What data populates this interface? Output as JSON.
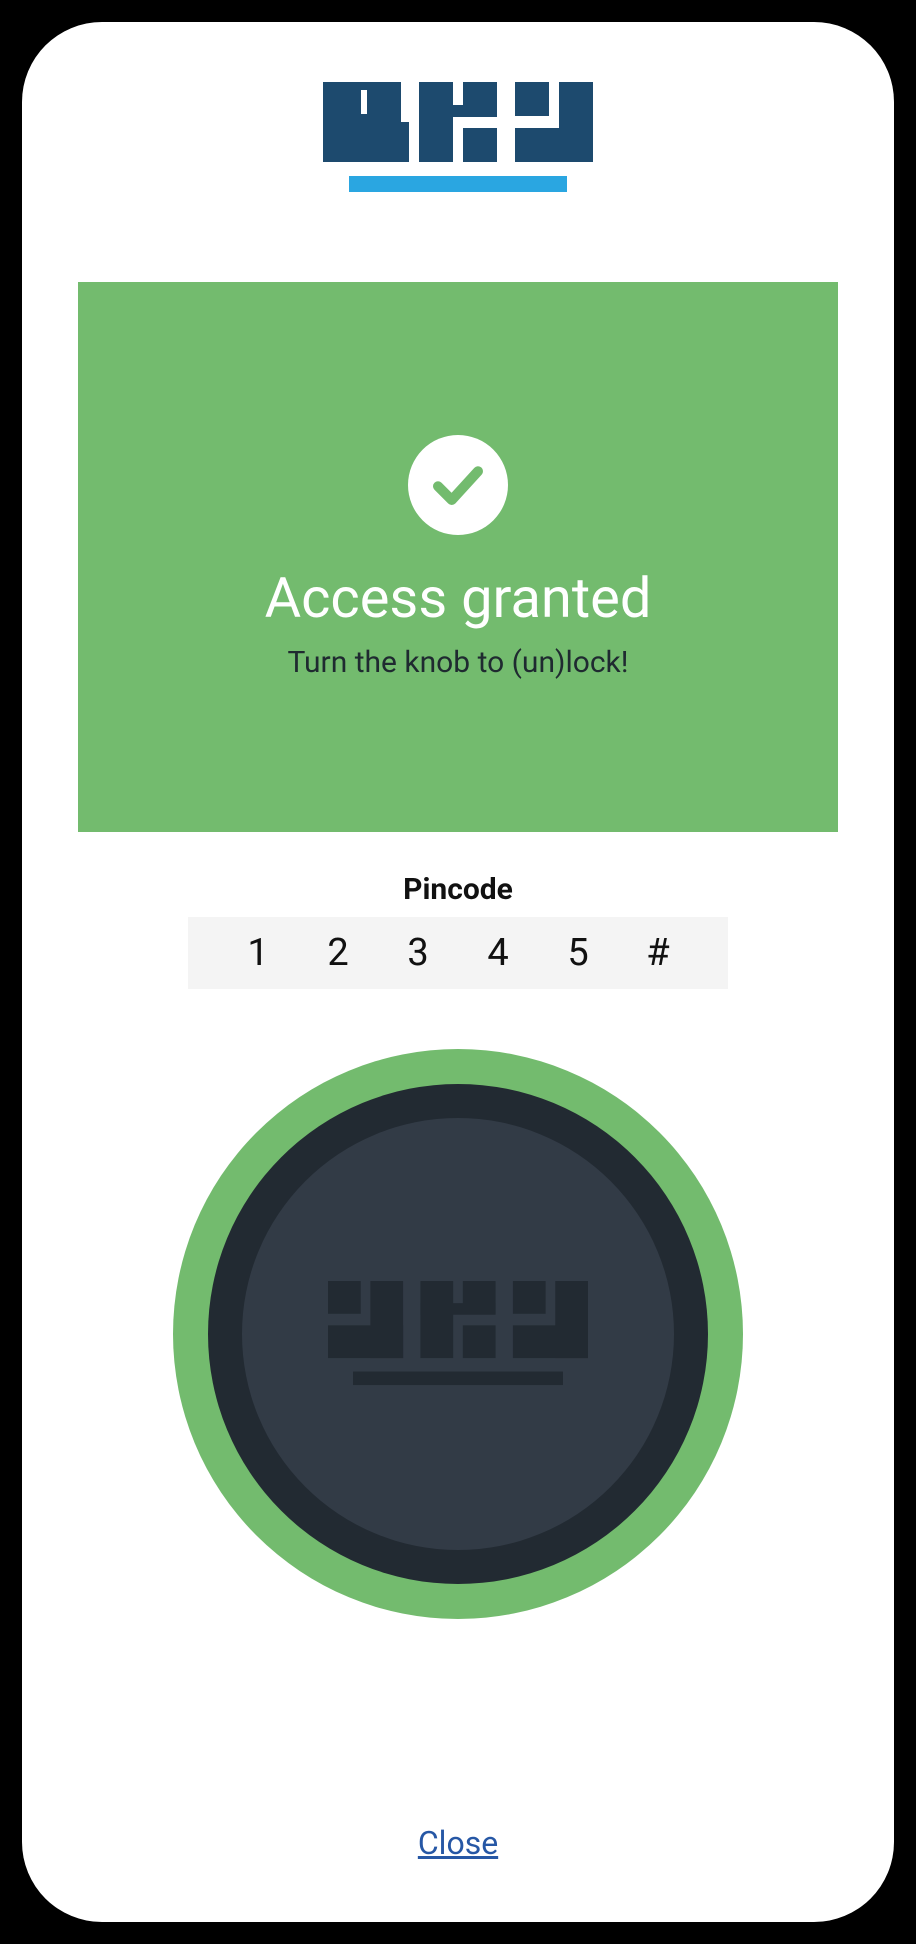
{
  "brand": "sbs",
  "colors": {
    "brand_dark": "#1d4a6e",
    "brand_light": "#2aa6e1",
    "success": "#73bb6e",
    "knob_outer": "#222a32",
    "knob_inner": "#323b46",
    "link": "#2657a5"
  },
  "status": {
    "icon": "check-icon",
    "title": "Access granted",
    "subtitle": "Turn the knob to (un)lock!"
  },
  "pincode": {
    "label": "Pincode",
    "digits": [
      "1",
      "2",
      "3",
      "4",
      "5",
      "#"
    ]
  },
  "knob": {
    "label": "sbs"
  },
  "actions": {
    "close": "Close"
  }
}
